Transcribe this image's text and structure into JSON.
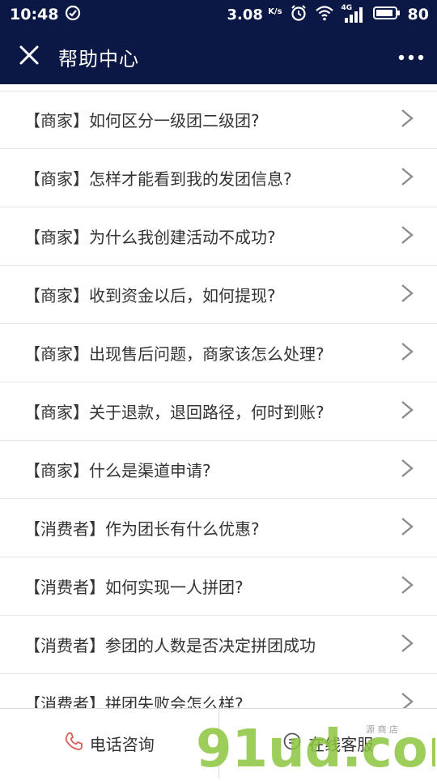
{
  "status_bar": {
    "time": "10:48",
    "speed": "3.08",
    "speed_unit": "K/s",
    "network_type": "4G",
    "battery": "80",
    "icons": [
      "check-circle-icon",
      "alarm-icon",
      "wifi-icon",
      "signal-icon",
      "battery-icon"
    ]
  },
  "header": {
    "title": "帮助中心",
    "close_icon": "close-icon",
    "more_icon": "more-dots-icon"
  },
  "faq_items": [
    {
      "label": "【商家】如何区分一级团二级团?"
    },
    {
      "label": "【商家】怎样才能看到我的发团信息?"
    },
    {
      "label": "【商家】为什么我创建活动不成功?"
    },
    {
      "label": "【商家】收到资金以后，如何提现?"
    },
    {
      "label": "【商家】出现售后问题，商家该怎么处理?"
    },
    {
      "label": "【商家】关于退款，退回路径，何时到账?"
    },
    {
      "label": "【商家】什么是渠道申请?"
    },
    {
      "label": "【消费者】作为团长有什么优惠?"
    },
    {
      "label": "【消费者】如何实现一人拼团?"
    },
    {
      "label": "【消费者】参团的人数是否决定拼团成功"
    },
    {
      "label": "【消费者】拼团失败会怎么样?"
    }
  ],
  "bottom_bar": {
    "phone_label": "电话咨询",
    "online_label": "在线客服",
    "phone_icon": "phone-icon",
    "chat_icon": "chat-icon"
  },
  "watermark": {
    "text": "91ud.com",
    "subtext": "源 商 店"
  },
  "colors": {
    "header_bg": "#0b1846",
    "text": "#333333",
    "divider": "#e6e6e6",
    "phone_icon": "#e05a5a",
    "watermark_green": "#8cc63f",
    "watermark_blue": "#2aa6e0"
  }
}
